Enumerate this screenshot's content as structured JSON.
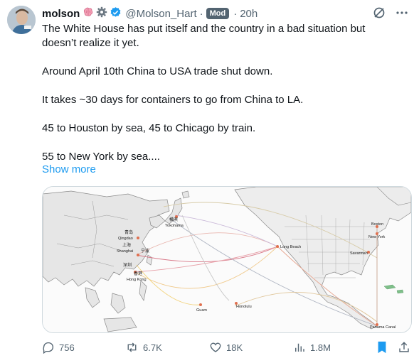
{
  "tweet": {
    "display_name": "molson",
    "handle": "@Molson_Hart",
    "badge": "Mod",
    "time": "20h",
    "paragraphs": [
      "The White House has put itself and the country in a bad situation but doesn’t realize it yet.",
      "Around April 10th China to USA trade shut down.",
      "It takes ~30 days for containers to go from China to LA.",
      "45 to Houston by sea, 45 to Chicago by train.",
      "55 to New York by sea...."
    ],
    "show_more": "Show more"
  },
  "map": {
    "labels": {
      "yokohama": "Yokohama",
      "yokohama_cn": "横滨",
      "qingdao": "Qingdao",
      "qingdao_cn": "青岛",
      "shanghai": "Shanghai",
      "shanghai_cn": "上海",
      "ningbo_cn": "宁波",
      "shenzhen_cn": "深圳",
      "hongkong": "Hong Kong",
      "hongkong_cn": "香港",
      "guam": "Guam",
      "honolulu": "Honolulu",
      "longbeach": "Long Beach",
      "boston": "Boston",
      "newyork": "New York",
      "savannah": "Savannah",
      "panama": "Panama Canal"
    }
  },
  "actions": {
    "replies": "756",
    "reposts": "6.7K",
    "likes": "18K",
    "views": "1.8M"
  },
  "colors": {
    "text": "#0f1419",
    "secondary": "#536471",
    "link": "#1d9bf0",
    "verified": "#1d9bf0",
    "bookmark_active": "#1d9bf0"
  }
}
